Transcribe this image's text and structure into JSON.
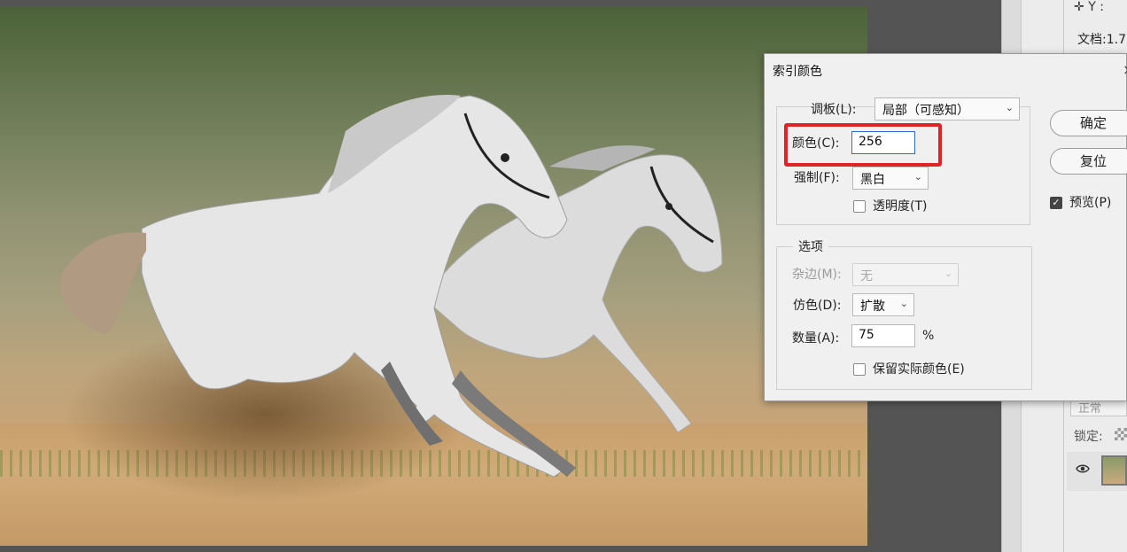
{
  "dialog": {
    "title": "索引颜色",
    "close": "×",
    "palette_label": "调板(L):",
    "palette_value": "局部（可感知）",
    "colors_label": "颜色(C):",
    "colors_value": "256",
    "forced_label": "强制(F):",
    "forced_value": "黑白",
    "transparency_label": "透明度(T)",
    "options_title": "选项",
    "matte_label": "杂边(M):",
    "matte_value": "无",
    "dither_label": "仿色(D):",
    "dither_value": "扩散",
    "amount_label": "数量(A):",
    "amount_value": "75",
    "amount_unit": "%",
    "preserve_label": "保留实际颜色(E)",
    "ok_label": "确定",
    "reset_label": "复位",
    "preview_label": "预览(P)",
    "preview_checked": true,
    "highlight_color": "#e0232a"
  },
  "right_panel": {
    "y_label": "Y :",
    "doc_info": "文档:1.7",
    "blend_mode": "正常",
    "lock_label": "锁定:"
  }
}
